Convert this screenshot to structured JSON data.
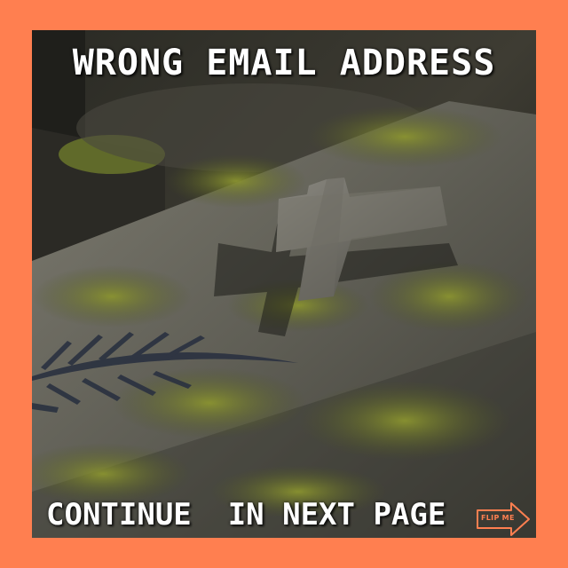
{
  "headline": "WRONG EMAIL ADDRESS",
  "footer": {
    "text": "CONTINUE  IN NEXT PAGE",
    "flip_label": "FLIP ME",
    "flip_icon": "right-arrow-icon"
  },
  "colors": {
    "border": "#ff7f50",
    "text": "#ffffff",
    "moss": "#6f7a2a",
    "stone": "#6c6b63"
  }
}
